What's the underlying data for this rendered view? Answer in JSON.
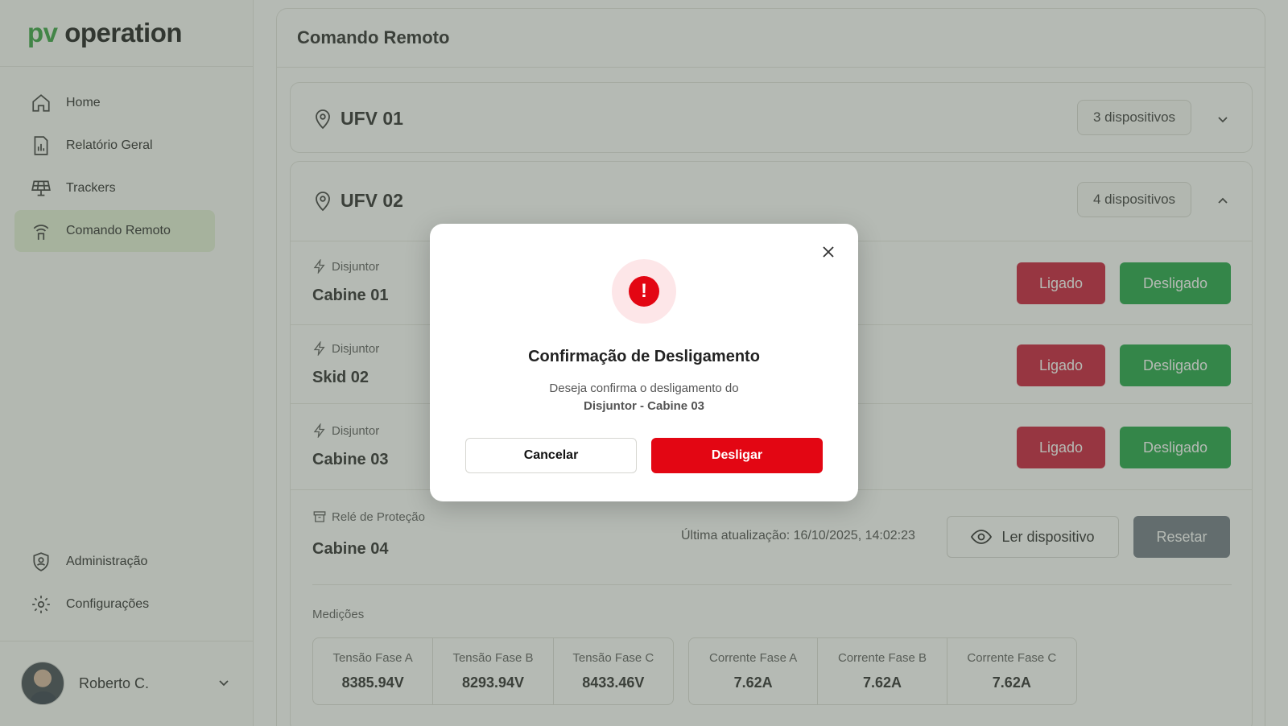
{
  "app": {
    "logo_prefix": "pv",
    "logo_word": "operation",
    "accent_color": "#2f9e3a"
  },
  "sidebar": {
    "items": [
      {
        "label": "Home",
        "icon": "home-icon"
      },
      {
        "label": "Relatório Geral",
        "icon": "report-icon"
      },
      {
        "label": "Trackers",
        "icon": "solar-panel-icon"
      },
      {
        "label": "Comando Remoto",
        "icon": "antenna-icon",
        "active": true
      }
    ],
    "bottom_items": [
      {
        "label": "Administração",
        "icon": "shield-user-icon"
      },
      {
        "label": "Configurações",
        "icon": "gear-icon"
      }
    ],
    "user": {
      "name": "Roberto C."
    }
  },
  "page": {
    "title": "Comando Remoto"
  },
  "groups": [
    {
      "name": "UFV 01",
      "count_label": "3 dispositivos",
      "expanded": false
    },
    {
      "name": "UFV 02",
      "count_label": "4 dispositivos",
      "expanded": true
    }
  ],
  "devices": [
    {
      "type": "Disjuntor",
      "name": "Cabine 01",
      "on_label": "Ligado",
      "off_label": "Desligado"
    },
    {
      "type": "Disjuntor",
      "name": "Skid 02",
      "on_label": "Ligado",
      "off_label": "Desligado"
    },
    {
      "type": "Disjuntor",
      "name": "Cabine 03",
      "on_label": "Ligado",
      "off_label": "Desligado"
    }
  ],
  "relay": {
    "type": "Relé de Proteção",
    "name": "Cabine 04",
    "last_update": "Última atualização: 16/10/2025, 14:02:23",
    "read_label": "Ler dispositivo",
    "reset_label": "Resetar",
    "measurements_title": "Medições",
    "voltages": [
      {
        "label": "Tensão Fase A",
        "value": "8385.94V"
      },
      {
        "label": "Tensão Fase B",
        "value": "8293.94V"
      },
      {
        "label": "Tensão Fase C",
        "value": "8433.46V"
      }
    ],
    "currents": [
      {
        "label": "Corrente Fase A",
        "value": "7.62A"
      },
      {
        "label": "Corrente Fase B",
        "value": "7.62A"
      },
      {
        "label": "Corrente Fase C",
        "value": "7.62A"
      }
    ]
  },
  "modal": {
    "title": "Confirmação de Desligamento",
    "text": "Deseja confirma o desligamento do",
    "device": "Disjuntor - Cabine 03",
    "cancel_label": "Cancelar",
    "confirm_label": "Desligar",
    "alert_symbol": "!",
    "danger_color": "#e30613"
  }
}
